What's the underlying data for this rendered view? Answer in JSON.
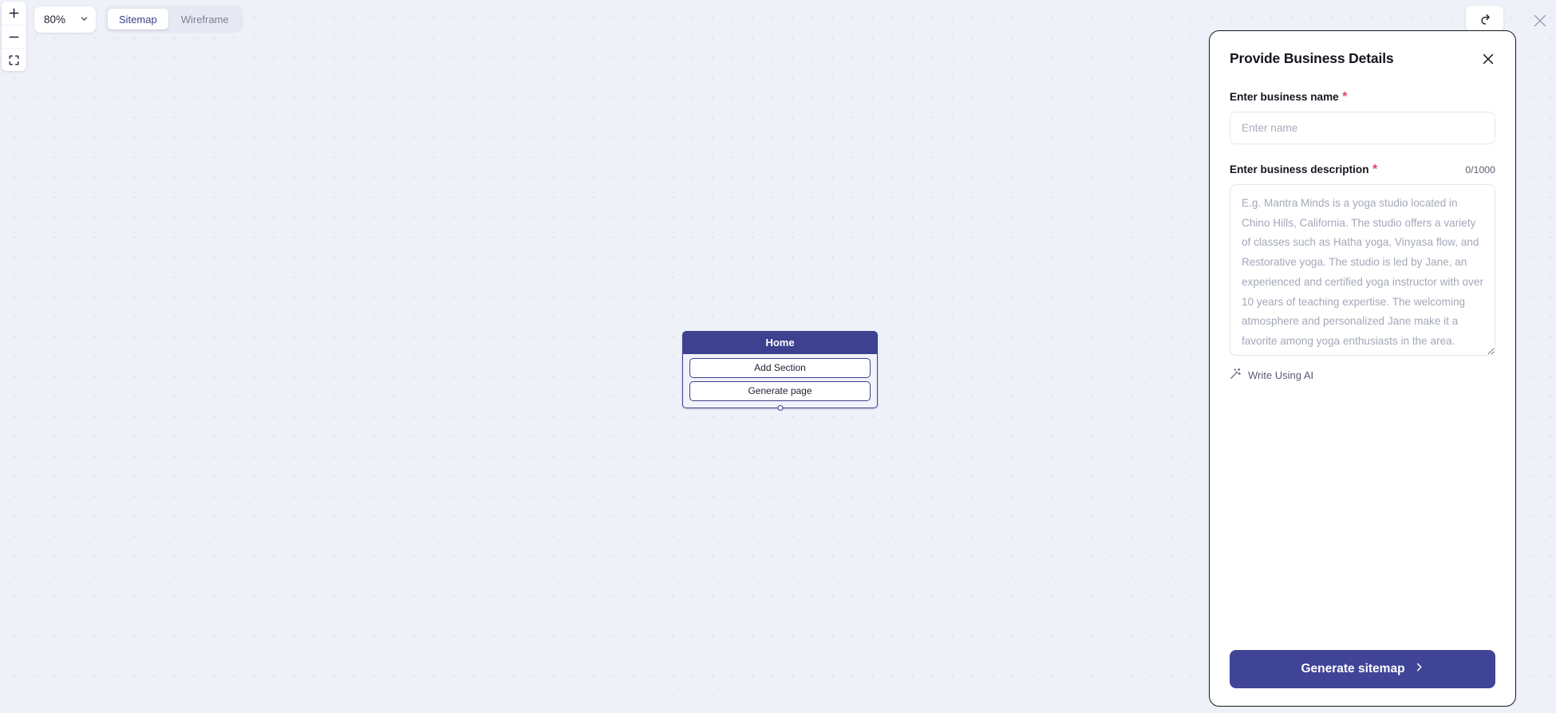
{
  "toolbar": {
    "zoom_level": "80%",
    "zoom_in_icon": "plus-icon",
    "zoom_out_icon": "minus-icon",
    "fit_screen_icon": "fit-to-screen-icon",
    "chevron_icon": "chevron-down-icon",
    "tabs": [
      {
        "label": "Sitemap",
        "active": true
      },
      {
        "label": "Wireframe",
        "active": false
      }
    ],
    "redo_icon": "redo-icon",
    "global_close_icon": "close-icon"
  },
  "canvas": {
    "node": {
      "title": "Home",
      "buttons": [
        {
          "label": "Add Section"
        },
        {
          "label": "Generate page"
        }
      ]
    }
  },
  "panel": {
    "title": "Provide Business Details",
    "close_icon": "close-icon",
    "name_field": {
      "label": "Enter business name",
      "required_marker": "*",
      "value": "",
      "placeholder": "Enter name"
    },
    "description_field": {
      "label": "Enter business description",
      "required_marker": "*",
      "counter": "0/1000",
      "value": "",
      "placeholder": "E.g. Mantra Minds is a yoga studio located in Chino Hills, California. The studio offers a variety of classes such as Hatha yoga, Vinyasa flow, and Restorative yoga. The studio is led by Jane, an experienced and certified yoga instructor with over 10 years of teaching expertise. The welcoming atmosphere and personalized Jane make it a favorite among yoga enthusiasts in the area."
    },
    "write_ai": {
      "label": "Write Using AI",
      "icon": "magic-wand-icon"
    },
    "submit": {
      "label": "Generate sitemap",
      "chevron_icon": "chevron-right-icon"
    }
  },
  "colors": {
    "accent": "#3f4496",
    "node_header": "#3d418f",
    "canvas_bg": "#eff1f9",
    "required": "#d9455f"
  }
}
